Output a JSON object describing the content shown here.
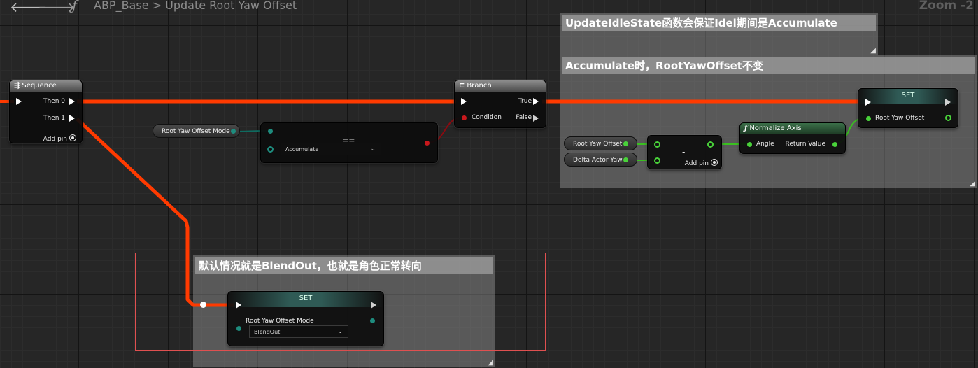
{
  "toolbar": {
    "back_icon": "arrow-left-icon",
    "forward_icon": "arrow-right-icon",
    "function_icon": "function-f-icon",
    "breadcrumb_graph": "ABP_Base",
    "breadcrumb_separator": ">",
    "breadcrumb_function": "Update Root Yaw Offset",
    "zoom_label": "Zoom -2"
  },
  "comments": {
    "idle_state": "UpdateIdleState函数会保证Idel期间是Accumulate",
    "accumulate": "Accumulate时，RootYawOffset不变",
    "blend_out": "默认情况就是BlendOut，也就是角色正常转向"
  },
  "nodes": {
    "sequence": {
      "title": "Sequence",
      "pins": [
        "Then 0",
        "Then 1"
      ],
      "add_pin": "Add pin"
    },
    "mode_getter": {
      "label": "Root Yaw Offset Mode"
    },
    "equal": {
      "title": "==",
      "selected_value": "Accumulate"
    },
    "branch": {
      "title": "Branch",
      "condition": "Condition",
      "true": "True",
      "false": "False"
    },
    "set_top": {
      "title": "SET",
      "pin": "Root Yaw Offset"
    },
    "offset_getter": {
      "label": "Root Yaw Offset"
    },
    "delta_getter": {
      "label": "Delta Actor Yaw"
    },
    "subtract": {
      "title": "-",
      "add_pin": "Add pin"
    },
    "normalize": {
      "title": "Normalize Axis",
      "input": "Angle",
      "output": "Return Value"
    },
    "set_bottom": {
      "title": "SET",
      "pin": "Root Yaw Offset Mode",
      "selected_value": "BlendOut"
    }
  },
  "colors": {
    "exec_wire": "#ff3a00",
    "float_wire": "#3ac020",
    "enum_wire": "#0f6b60",
    "bool_wire": "#8b0a10",
    "selection": "#e05050"
  }
}
